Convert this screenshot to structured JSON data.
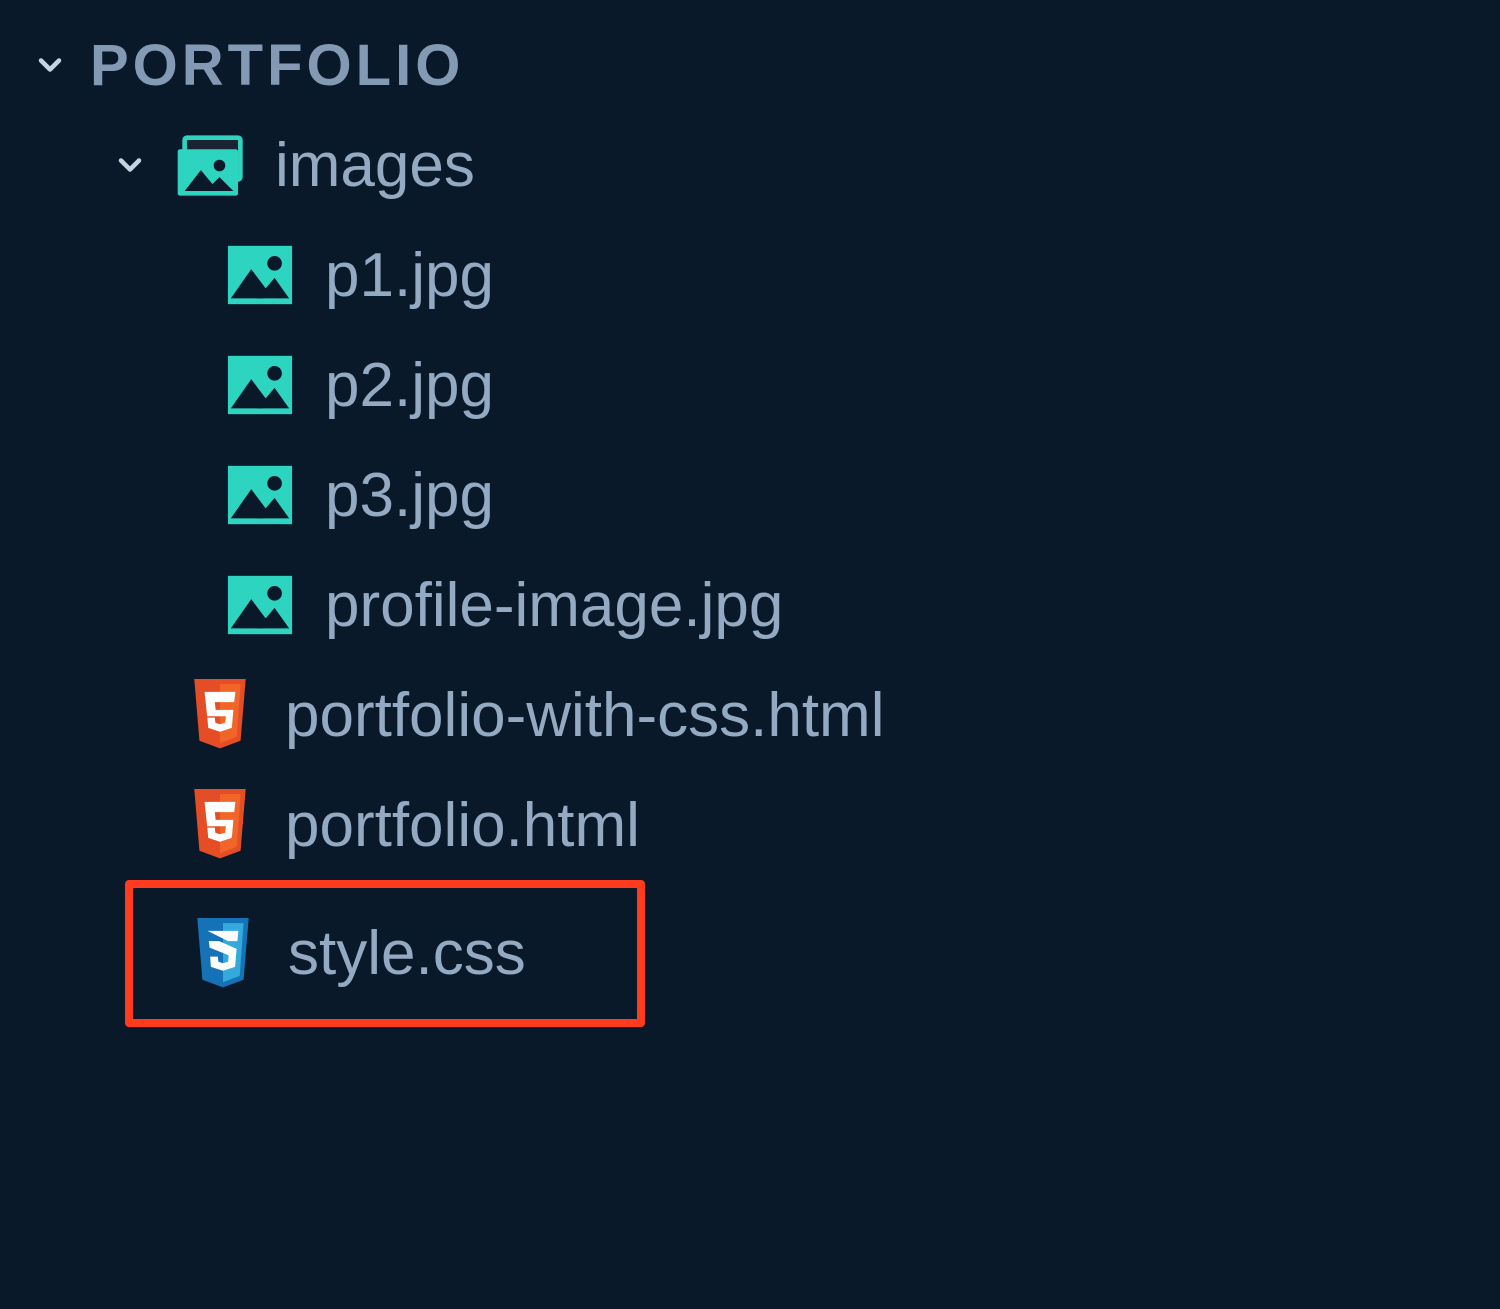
{
  "root": {
    "name": "PORTFOLIO"
  },
  "folder": {
    "name": "images"
  },
  "files": {
    "images": [
      {
        "name": "p1.jpg",
        "type": "image"
      },
      {
        "name": "p2.jpg",
        "type": "image"
      },
      {
        "name": "p3.jpg",
        "type": "image"
      },
      {
        "name": "profile-image.jpg",
        "type": "image"
      }
    ],
    "root": [
      {
        "name": "portfolio-with-css.html",
        "type": "html"
      },
      {
        "name": "portfolio.html",
        "type": "html"
      },
      {
        "name": "style.css",
        "type": "css",
        "highlighted": true
      }
    ]
  }
}
